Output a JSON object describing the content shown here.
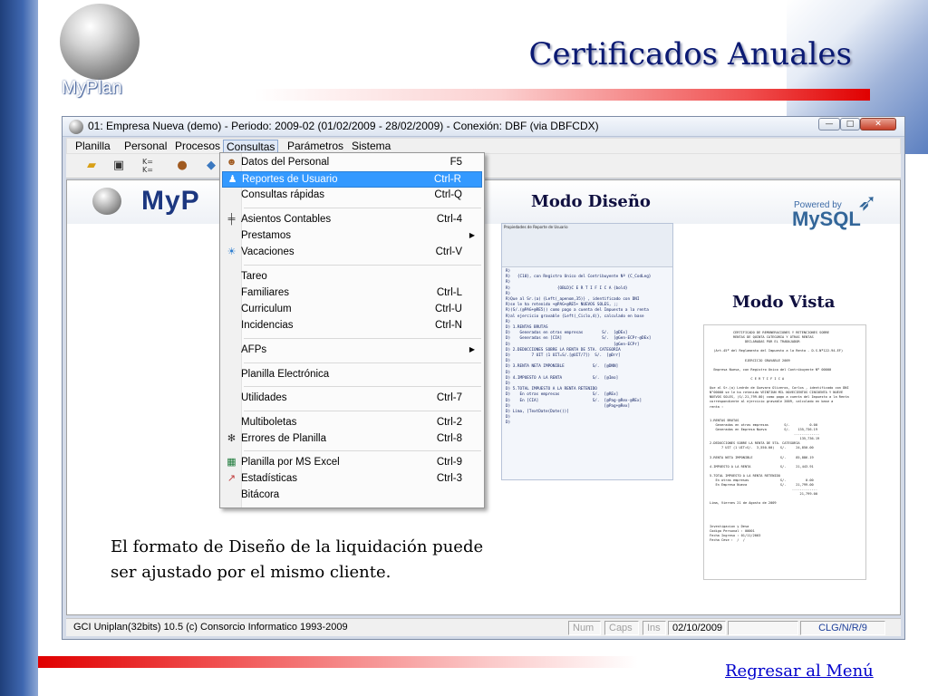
{
  "slide": {
    "logo_text": "MyPlan",
    "title": "Certificados Anuales",
    "caption_line1": "El formato de  Diseño de la liquidación puede",
    "caption_line2": "ser ajustado por el mismo cliente.",
    "back_link": "Regresar al Menú",
    "mode_design": "Modo Diseño",
    "mode_view": "Modo Vista"
  },
  "window": {
    "title": "01: Empresa Nueva  (demo)  - Periodo: 2009-02 (01/02/2009 - 28/02/2009) - Conexión: DBF (via DBFCDX)",
    "buttons": {
      "minimize": "—",
      "maximize": "□",
      "close": "✕"
    }
  },
  "menubar": [
    "Planilla",
    "Personal",
    "Procesos",
    "Consultas",
    "Parámetros",
    "Sistema"
  ],
  "banner": {
    "logo": "MyP",
    "powered_by": "Powered by",
    "mysql": "MySQL"
  },
  "dropdown": {
    "items": [
      {
        "label": "Datos del Personal",
        "shortcut": "F5",
        "icon": "person-icon"
      },
      {
        "label": "Reportes de Usuario",
        "shortcut": "Ctrl-R",
        "icon": "users-icon",
        "highlight": true
      },
      {
        "label": "Consultas rápidas",
        "shortcut": "Ctrl-Q"
      },
      {
        "label": "Asientos Contables",
        "shortcut": "Ctrl-4",
        "icon": "ledger-icon"
      },
      {
        "label": "Prestamos",
        "shortcut": "",
        "submenu": true
      },
      {
        "label": "Vacaciones",
        "shortcut": "Ctrl-V",
        "icon": "beach-icon"
      },
      {
        "label": "Tareo",
        "shortcut": ""
      },
      {
        "label": "Familiares",
        "shortcut": "Ctrl-L"
      },
      {
        "label": "Curriculum",
        "shortcut": "Ctrl-U"
      },
      {
        "label": "Incidencias",
        "shortcut": "Ctrl-N"
      },
      {
        "label": "AFPs",
        "shortcut": "",
        "submenu": true
      },
      {
        "label": "Planilla Electrónica",
        "shortcut": ""
      },
      {
        "label": "Utilidades",
        "shortcut": "Ctrl-7"
      },
      {
        "label": "Multiboletas",
        "shortcut": "Ctrl-2"
      },
      {
        "label": "Errores de Planilla",
        "shortcut": "Ctrl-8",
        "icon": "gear-icon"
      },
      {
        "label": "Planilla por MS Excel",
        "shortcut": "Ctrl-9",
        "icon": "excel-icon"
      },
      {
        "label": "Estadísticas",
        "shortcut": "Ctrl-3",
        "icon": "chart-icon"
      },
      {
        "label": "Bitácora",
        "shortcut": ""
      }
    ]
  },
  "design_preview": {
    "title": "Propiedades de Reporte de Usuario",
    "lines": [
      "R)",
      "R)   {C10}, con Registro Unico del Contribuyente Nº {C_CodLeg}",
      "R)",
      "R)                    {OBLD}C E R T I F I C A {bold}",
      "R)",
      "R)Que al Sr.(a) {Left(_apenom,35)} , identificado con DNI",
      "R)se le ha retenido +@PAG+@RE5+ NUEVOS SOLES, ;;",
      "R)(S/.(@PAG+@RE5)) como pago a cuenta del Impuesto a la renta",
      "R)al ejercicio gravable {Left(_Ciclo,4)}, calculado en base",
      "R)",
      "D) 1.RENTAS BRUTAS",
      "D)    Generadas en otras empresas        S/.  [@DEx]",
      "D)    Generadas en [CIA]                 S/.  [@Gen-ECPr-@DEx]",
      "D)                                            [@Gen-ECPr]",
      "D) 2.DEDUCCIONES SOBRE LA RENTA DE 5TA. CATEGORIA",
      "D)         7 UIT (1 UIT=S/.[@UIT/7])  S/.  [@Drr]",
      "D)",
      "D) 3.RENTA NETA IMPONIBLE            S/.  [@DNN]",
      "D)",
      "D) 4.IMPUESTO A LA RENTA             S/.  [@Imo]",
      "D)",
      "D) 5.TOTAL IMPUESTO A LA RENTA RETENIDO",
      "D)    En otras empresas              S/.  [@REx]",
      "D)    En [CIA]                       S/.  [@Pag-@Rex-@REx]",
      "D)                                        [@Pag+@Rex]",
      "D) Lima, [TextDate(Date())]",
      "D)",
      "D)"
    ]
  },
  "view_preview": {
    "lines": [
      "            CERTIFICADO DE REMUNERACIONES Y RETENCIONES SOBRE",
      "            RENTAS DE QUINTA CATEGORIA Y OTRAS RENTAS",
      "                  DECLARADAS POR EL TRABAJADOR",
      "",
      "  (Art.45º del Reglamento del Impuesto a la Renta - D.S.Nº122-94-EF)",
      "",
      "                  EJERCICIO GRAVABLE 2009",
      "",
      "  Empresa Nueva, con Registro Unico del Contribuyente Nº 00000",
      "",
      "                     C E R T I F I C A",
      "",
      "Que al Sr.(a) Ledrón de Guevara Oliveros, Carlos , identificado con DNI",
      "N°00000 se le ha retenido VEINTIUN MIL NOVECIENTOS CINCUENTA Y NUEVE",
      "NUEVOS SOLES, (S/.21,799.00) como pago a cuenta del Impuesto a la Renta",
      "correspondiente al ejercicio gravable 2009, calculado en base a",
      "renta :",
      "",
      "",
      "1.RENTAS BRUTAS",
      "   Generadas en otras empresas        S/.          0.00",
      "   Generadas en Empresa Nueva         S/.    135,736.19",
      "                                           -------------",
      "                                              135,736.19",
      "2.DEDUCCIONES SOBRE LA RENTA DE 5TA. CATEGORIA",
      "      7 UIT (1 UIT=S/.  3,550.00)   S/.     24,850.00",
      "",
      "3.RENTA NETA IMPONIBLE              S/.     85,886.19",
      "",
      "4.IMPUESTO A LA RENTA               S/.     21,443.91",
      "",
      "5.TOTAL IMPUESTO A LA RENTA RETENIDO",
      "   En otras empresas                S/.          0.00",
      "   En Empresa Nueva                 S/.     21,799.00",
      "                                          -------------",
      "                                              21,799.00",
      "",
      "Lima, Viernes 21 de Agosto de 2009",
      "",
      "",
      "",
      "",
      "Investigacion y Desa",
      "Codigo Personal : 00001",
      "Fecha Ingreso : 01/11/2003",
      "Fecha Cese :  /  /"
    ]
  },
  "statusbar": {
    "app": "GCI Uniplan(32bits) 10.5  (c) Consorcio Informatico 1993-2009",
    "num": "Num",
    "caps": "Caps",
    "ins": "Ins",
    "date": "02/10/2009",
    "mode": "CLG/N/R/9"
  }
}
